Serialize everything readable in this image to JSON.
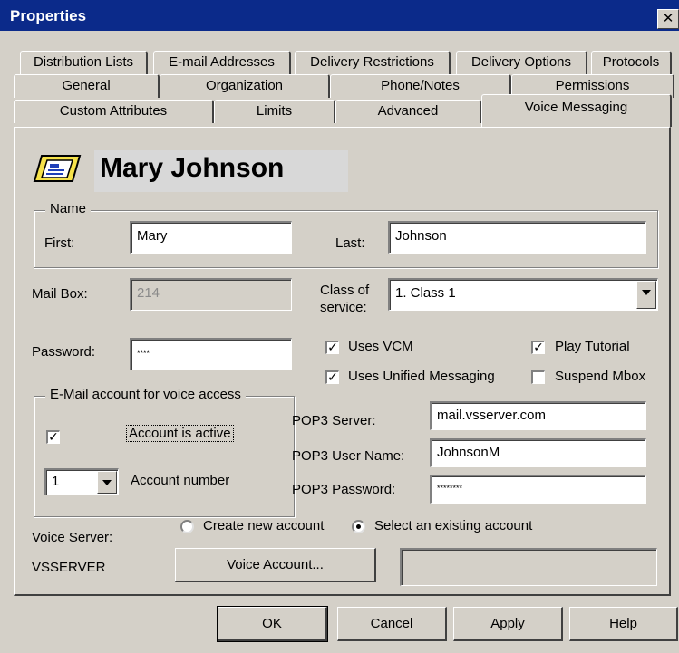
{
  "window": {
    "title": "Properties",
    "close_glyph": "✕"
  },
  "tabs": {
    "row1": [
      "Distribution Lists",
      "E-mail Addresses",
      "Delivery Restrictions",
      "Delivery Options",
      "Protocols"
    ],
    "row2": [
      "General",
      "Organization",
      "Phone/Notes",
      "Permissions"
    ],
    "row3": [
      "Custom Attributes",
      "Limits",
      "Advanced",
      "Voice Messaging"
    ],
    "active": "Voice Messaging"
  },
  "header": {
    "display_name": "Mary Johnson",
    "icon": "mailbox-card-icon"
  },
  "name_group": {
    "label": "Name",
    "first_label": "First:",
    "first_value": "Mary",
    "last_label": "Last:",
    "last_value": "Johnson"
  },
  "mailbox": {
    "label": "Mail Box:",
    "value": "214"
  },
  "class_of_service": {
    "label_line1": "Class of",
    "label_line2": "service:",
    "value": "1. Class 1"
  },
  "password": {
    "label": "Password:",
    "value": "****"
  },
  "options": {
    "uses_vcm": {
      "label": "Uses VCM",
      "checked": true
    },
    "play_tutorial": {
      "label": "Play Tutorial",
      "checked": true
    },
    "uses_unified": {
      "label": "Uses Unified Messaging",
      "checked": true
    },
    "suspend_mbox": {
      "label": "Suspend Mbox",
      "checked": false
    }
  },
  "email_group": {
    "label": "E-Mail account for voice access",
    "account_active_label": "Account is active",
    "account_active_checked": true,
    "account_number_label": "Account number",
    "account_number_value": "1",
    "pop3_server_label": "POP3 Server:",
    "pop3_server_value": "mail.vsserver.com",
    "pop3_user_label": "POP3 User Name:",
    "pop3_user_value": "JohnsonM",
    "pop3_password_label": "POP3 Password:",
    "pop3_password_value": "********"
  },
  "voice_server": {
    "label": "Voice Server:",
    "server_name": "VSSERVER",
    "create_new_label": "Create new account",
    "select_existing_label": "Select an existing account",
    "selected": "select_existing",
    "voice_account_button": "Voice Account...",
    "account_display_value": ""
  },
  "footer": {
    "ok": "OK",
    "cancel": "Cancel",
    "apply": "Apply",
    "help": "Help"
  },
  "colors": {
    "titlebar": "#0b2a8a",
    "face": "#d4d0c8",
    "disabled_text": "#8a8a8a"
  }
}
